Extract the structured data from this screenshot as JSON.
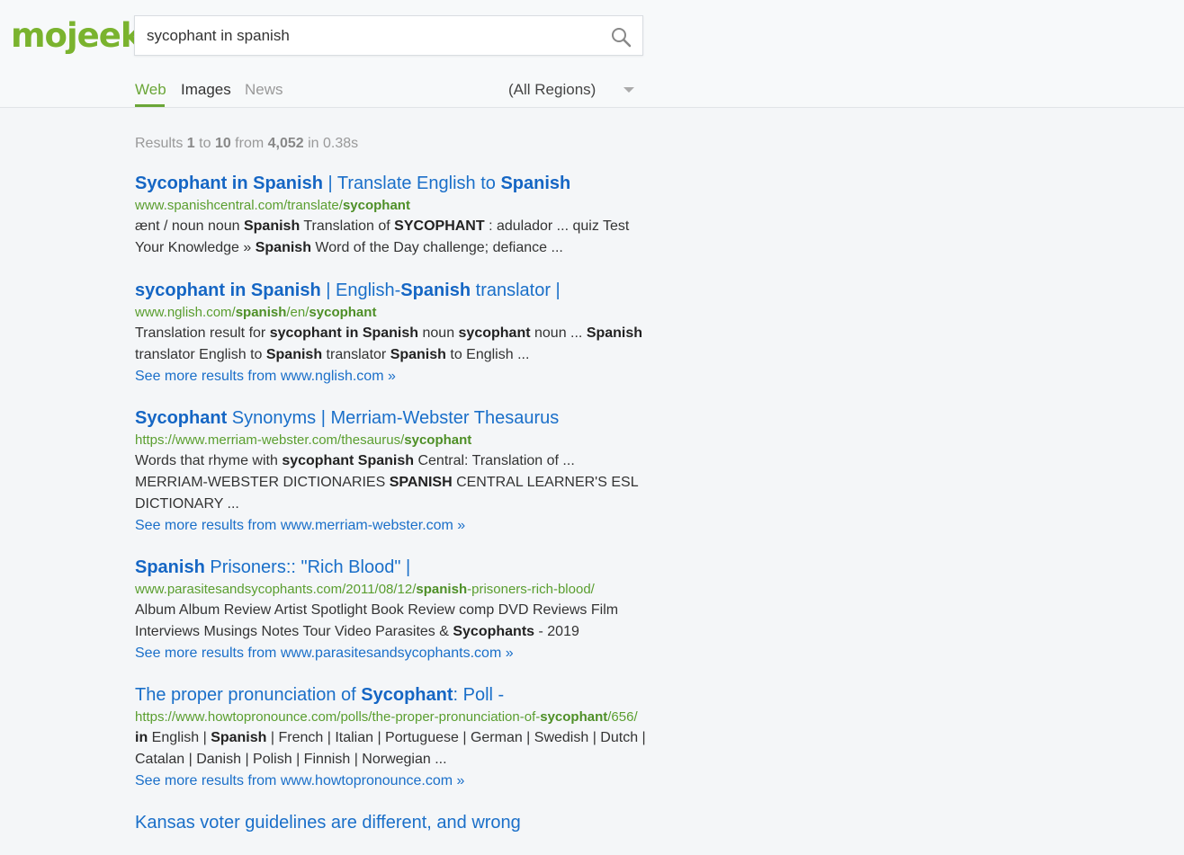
{
  "logo": "mojeek",
  "search": {
    "value": "sycophant in spanish",
    "icon": "search-icon"
  },
  "tabs": [
    {
      "label": "Web",
      "active": true
    },
    {
      "label": "Images",
      "active": false
    },
    {
      "label": "News",
      "active": false
    }
  ],
  "region": {
    "label": "(All Regions)"
  },
  "results_count": {
    "prefix": "Results ",
    "start": "1",
    "to": " to ",
    "end": "10",
    "from": " from ",
    "total": "4,052",
    "time": " in 0.38s"
  },
  "results": [
    {
      "title": [
        {
          "t": "Sycophant in Spanish",
          "b": true
        },
        {
          "t": " | Translate English to ",
          "b": false
        },
        {
          "t": "Spanish",
          "b": true
        }
      ],
      "url": [
        {
          "t": "www.spanishcentral.com/translate/",
          "b": false
        },
        {
          "t": "sycophant",
          "b": true
        }
      ],
      "snippet": [
        {
          "t": "ænt / noun noun ",
          "b": false
        },
        {
          "t": "Spanish",
          "b": true
        },
        {
          "t": " Translation of ",
          "b": false
        },
        {
          "t": "SYCOPHANT",
          "b": true
        },
        {
          "t": " : adulador ... quiz Test Your Knowledge » ",
          "b": false
        },
        {
          "t": "Spanish",
          "b": true
        },
        {
          "t": " Word of the Day challenge; defiance ...",
          "b": false
        }
      ],
      "more": ""
    },
    {
      "title": [
        {
          "t": "sycophant in Spanish",
          "b": true
        },
        {
          "t": " | English-",
          "b": false
        },
        {
          "t": "Spanish",
          "b": true
        },
        {
          "t": " translator |",
          "b": false
        }
      ],
      "url": [
        {
          "t": "www.nglish.com/",
          "b": false
        },
        {
          "t": "spanish",
          "b": true
        },
        {
          "t": "/en/",
          "b": false
        },
        {
          "t": "sycophant",
          "b": true
        }
      ],
      "snippet": [
        {
          "t": "Translation result for ",
          "b": false
        },
        {
          "t": "sycophant in Spanish",
          "b": true
        },
        {
          "t": " noun ",
          "b": false
        },
        {
          "t": "sycophant",
          "b": true
        },
        {
          "t": " noun ... ",
          "b": false
        },
        {
          "t": "Spanish",
          "b": true
        },
        {
          "t": " translator English to ",
          "b": false
        },
        {
          "t": "Spanish",
          "b": true
        },
        {
          "t": " translator ",
          "b": false
        },
        {
          "t": "Spanish",
          "b": true
        },
        {
          "t": " to English ...",
          "b": false
        }
      ],
      "more": "See more results from www.nglish.com »"
    },
    {
      "title": [
        {
          "t": "Sycophant",
          "b": true
        },
        {
          "t": " Synonyms | Merriam-Webster Thesaurus",
          "b": false
        }
      ],
      "url": [
        {
          "t": "https://www.merriam-webster.com/thesaurus/",
          "b": false
        },
        {
          "t": "sycophant",
          "b": true
        }
      ],
      "snippet": [
        {
          "t": "Words that rhyme with ",
          "b": false
        },
        {
          "t": "sycophant Spanish",
          "b": true
        },
        {
          "t": " Central: Translation of ... MERRIAM-WEBSTER DICTIONARIES ",
          "b": false
        },
        {
          "t": "SPANISH",
          "b": true
        },
        {
          "t": " CENTRAL LEARNER'S ESL DICTIONARY ...",
          "b": false
        }
      ],
      "more": "See more results from www.merriam-webster.com »"
    },
    {
      "title": [
        {
          "t": "Spanish",
          "b": true
        },
        {
          "t": " Prisoners:: \"Rich Blood\" |",
          "b": false
        }
      ],
      "url": [
        {
          "t": "www.parasitesandsycophants.com/2011/08/12/",
          "b": false
        },
        {
          "t": "spanish",
          "b": true
        },
        {
          "t": "-prisoners-rich-blood/",
          "b": false
        }
      ],
      "snippet": [
        {
          "t": "Album Album Review Artist Spotlight Book Review comp DVD Reviews Film Interviews Musings Notes Tour Video Parasites & ",
          "b": false
        },
        {
          "t": "Sycophants",
          "b": true
        },
        {
          "t": " - 2019",
          "b": false
        }
      ],
      "more": "See more results from www.parasitesandsycophants.com »"
    },
    {
      "title": [
        {
          "t": "The proper pronunciation of ",
          "b": false
        },
        {
          "t": "Sycophant",
          "b": true
        },
        {
          "t": ": Poll -",
          "b": false
        }
      ],
      "url": [
        {
          "t": "https://www.howtopronounce.com/polls/the-proper-pronunciation-of-",
          "b": false
        },
        {
          "t": "sycophant",
          "b": true
        },
        {
          "t": "/656/",
          "b": false
        }
      ],
      "snippet": [
        {
          "t": "in",
          "b": true
        },
        {
          "t": " English | ",
          "b": false
        },
        {
          "t": "Spanish",
          "b": true
        },
        {
          "t": " | French | Italian | Portuguese | German | Swedish | Dutch | Catalan | Danish | Polish | Finnish | Norwegian ...",
          "b": false
        }
      ],
      "more": "See more results from www.howtopronounce.com »"
    },
    {
      "title": [
        {
          "t": "Kansas voter guidelines are different, and wrong",
          "b": false
        }
      ],
      "url": [],
      "snippet": [],
      "more": ""
    }
  ]
}
